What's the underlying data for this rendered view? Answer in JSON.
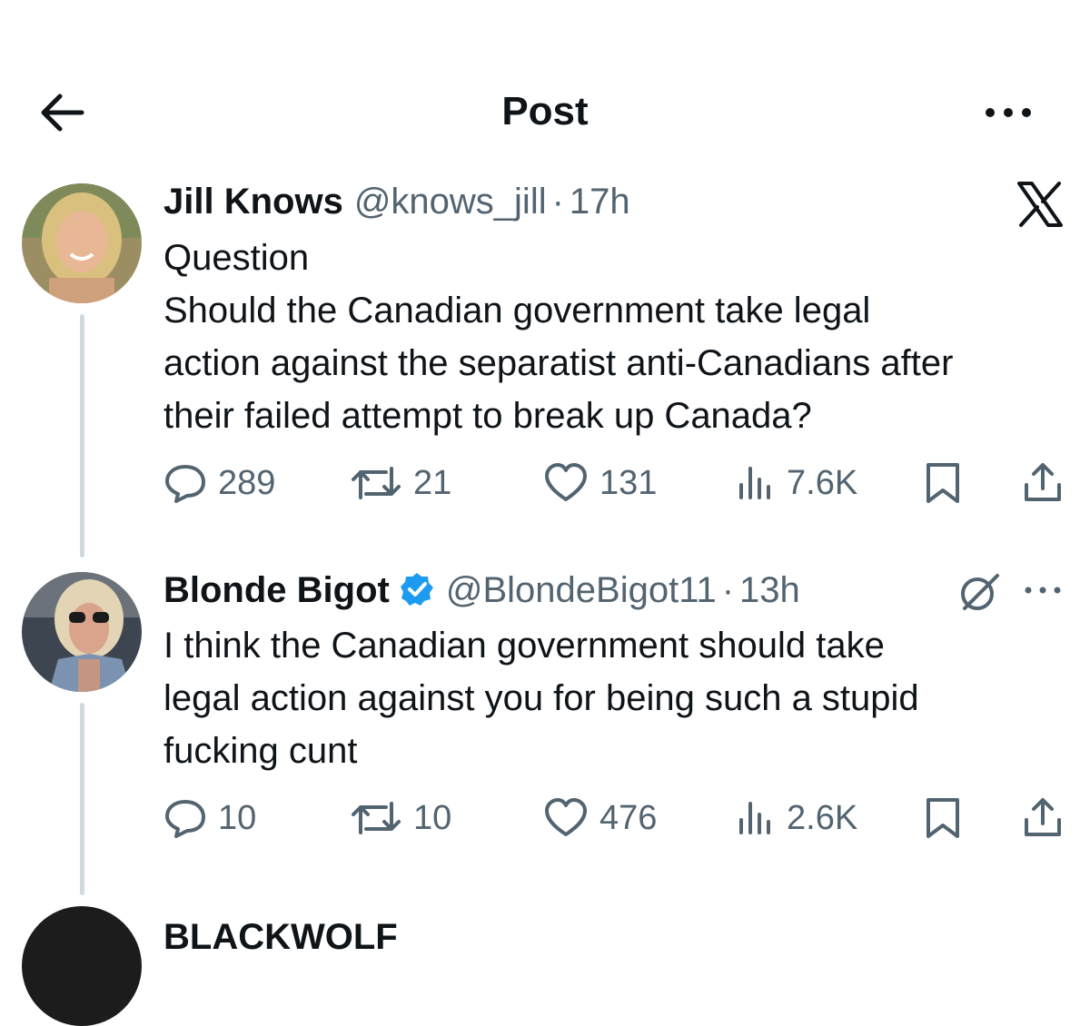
{
  "header": {
    "title": "Post"
  },
  "tweets": [
    {
      "name": "Jill Knows",
      "handle": "@knows_jill",
      "separator": "·",
      "time": "17h",
      "lines": [
        "Question",
        "Should the Canadian government take legal",
        "action against the separatist anti-Canadians after",
        "their failed attempt to break up Canada?"
      ],
      "stats": {
        "replies": "289",
        "reposts": "21",
        "likes": "131",
        "views": "7.6K"
      }
    },
    {
      "name": "Blonde Bigot",
      "handle": "@BlondeBigot11",
      "separator": "·",
      "time": "13h",
      "verified": true,
      "lines": [
        "I think the Canadian government should take",
        "legal action against you for being such a stupid",
        "fucking cunt"
      ],
      "stats": {
        "replies": "10",
        "reposts": "10",
        "likes": "476",
        "views": "2.6K"
      }
    },
    {
      "name": "BLACKWOLF"
    }
  ],
  "icons": {
    "back": "arrow-left-icon",
    "more": "more-horizontal-icon",
    "x_logo": "x-logo-icon",
    "grok": "grok-icon",
    "reply": "reply-icon",
    "repost": "repost-icon",
    "like": "heart-icon",
    "views": "views-icon",
    "bookmark": "bookmark-icon",
    "share": "share-icon"
  },
  "colors": {
    "text": "#0f1419",
    "secondary": "#536471",
    "verified": "#1d9bf0",
    "thread_line": "#cfd9de"
  }
}
